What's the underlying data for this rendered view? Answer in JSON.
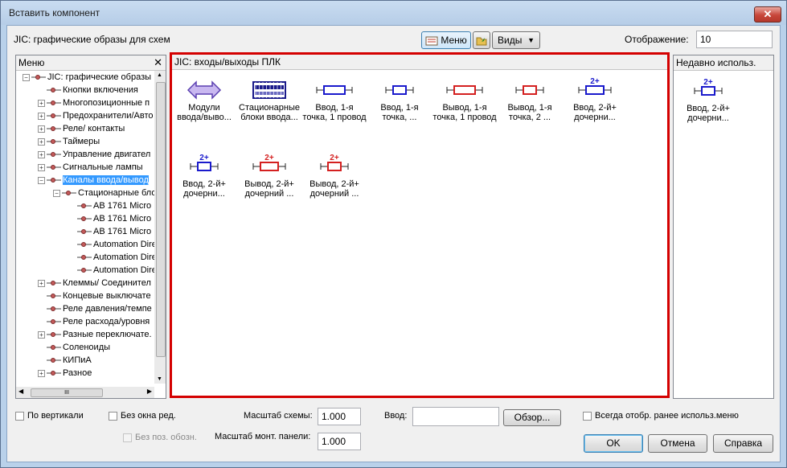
{
  "window": {
    "title": "Вставить компонент"
  },
  "toolbar": {
    "library_label": "JIC: графические образы для схем",
    "menu_button": "Меню",
    "views_button": "Виды",
    "display_label": "Отображение:",
    "display_value": "10"
  },
  "menu_panel": {
    "title": "Меню",
    "items": [
      {
        "label": "JIC: графические образы",
        "level": 0,
        "expander": "−"
      },
      {
        "label": "Кнопки включения",
        "level": 1,
        "expander": ""
      },
      {
        "label": "Многопозиционные п",
        "level": 1,
        "expander": "+"
      },
      {
        "label": "Предохранители/Авто",
        "level": 1,
        "expander": "+"
      },
      {
        "label": "Реле/ контакты",
        "level": 1,
        "expander": "+"
      },
      {
        "label": "Таймеры",
        "level": 1,
        "expander": "+"
      },
      {
        "label": "Управление двигател",
        "level": 1,
        "expander": "+"
      },
      {
        "label": "Сигнальные лампы",
        "level": 1,
        "expander": "+"
      },
      {
        "label": "Каналы ввода/вывод",
        "level": 1,
        "expander": "−"
      },
      {
        "label": "Стационарные бло",
        "level": 2,
        "expander": "−"
      },
      {
        "label": "AB 1761 Micro",
        "level": 3,
        "expander": ""
      },
      {
        "label": "AB 1761 Micro",
        "level": 3,
        "expander": ""
      },
      {
        "label": "AB 1761 Micro",
        "level": 3,
        "expander": ""
      },
      {
        "label": "Automation Dire",
        "level": 3,
        "expander": ""
      },
      {
        "label": "Automation Dire",
        "level": 3,
        "expander": ""
      },
      {
        "label": "Automation Dire",
        "level": 3,
        "expander": ""
      },
      {
        "label": "Клеммы/ Соединител",
        "level": 1,
        "expander": "+"
      },
      {
        "label": "Концевые выключате",
        "level": 1,
        "expander": ""
      },
      {
        "label": "Реле давления/темпе",
        "level": 1,
        "expander": ""
      },
      {
        "label": "Реле расхода/уровня",
        "level": 1,
        "expander": ""
      },
      {
        "label": "Разные переключате.",
        "level": 1,
        "expander": "+"
      },
      {
        "label": "Соленоиды",
        "level": 1,
        "expander": ""
      },
      {
        "label": "КИПиА",
        "level": 1,
        "expander": ""
      },
      {
        "label": "Разное",
        "level": 1,
        "expander": "+"
      }
    ],
    "selected_index": 8,
    "hscroll_thumb": "III"
  },
  "main_panel": {
    "title": "JIC: входы/выходы ПЛК",
    "tiles": [
      {
        "icon": "double-arrow-icon",
        "label1": "Модули",
        "label2": "ввода/выво..."
      },
      {
        "icon": "terminal-block-icon",
        "label1": "Стационарные",
        "label2": "блоки ввода..."
      },
      {
        "icon": "input-box-blue-icon",
        "label1": "Ввод, 1-я",
        "label2": "точка, 1 провод"
      },
      {
        "icon": "input-box-blue-small-icon",
        "label1": "Ввод, 1-я",
        "label2": "точка, ..."
      },
      {
        "icon": "output-box-red-icon",
        "label1": "Вывод, 1-я",
        "label2": "точка, 1 провод"
      },
      {
        "icon": "output-box-red-small-icon",
        "label1": "Вывод, 1-я",
        "label2": "точка, 2 ..."
      },
      {
        "icon": "input-child-blue-icon",
        "label1": "Ввод, 2-й+",
        "label2": "дочерни..."
      },
      {
        "icon": "input-child-blue-small-icon",
        "label1": "Ввод, 2-й+",
        "label2": "дочерни..."
      },
      {
        "icon": "output-child-red-icon",
        "label1": "Вывод, 2-й+",
        "label2": "дочерний ..."
      },
      {
        "icon": "output-child-red-small-icon",
        "label1": "Вывод, 2-й+",
        "label2": "дочерний ..."
      }
    ],
    "badge": "2+"
  },
  "recent_panel": {
    "title": "Недавно использ.",
    "tiles": [
      {
        "icon": "input-child-blue-small-icon",
        "label1": "Ввод, 2-й+",
        "label2": "дочерни..."
      }
    ]
  },
  "bottom": {
    "vertical_label": "По вертикали",
    "no_edit_window_label": "Без окна ред.",
    "no_pos_label": "Без поз. обозн.",
    "scale_schema_label": "Масштаб схемы:",
    "scale_schema_value": "1.000",
    "scale_panel_label": "Масштаб монт. панели:",
    "scale_panel_value": "1.000",
    "input_label": "Ввод:",
    "input_value": "",
    "browse_button": "Обзор...",
    "always_show_label": "Всегда отобр. ранее использ.меню",
    "ok_button": "OK",
    "cancel_button": "Отмена",
    "help_button": "Справка"
  },
  "colors": {
    "input_blue": "#1a1acc",
    "output_red": "#d42020",
    "highlight_red": "#d40000",
    "selection": "#3399ff"
  }
}
